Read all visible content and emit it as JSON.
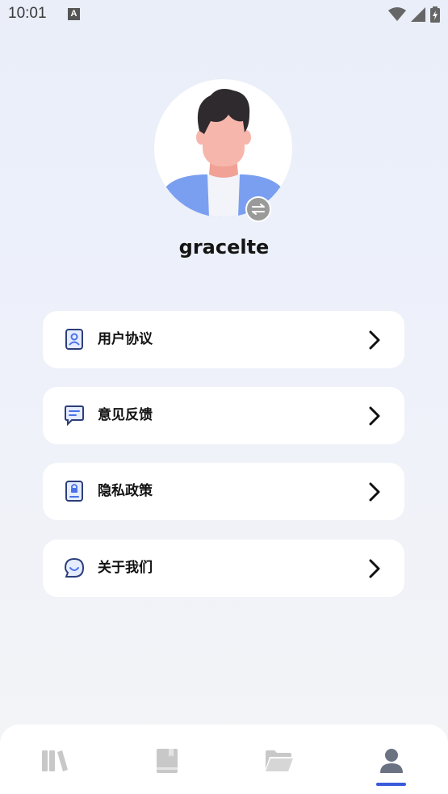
{
  "status_bar": {
    "time": "10:01",
    "notification_icon": "A"
  },
  "profile": {
    "username": "gracelte",
    "avatar_icon": "user-avatar-illustration",
    "swap_icon": "swap-arrows-icon"
  },
  "menu": [
    {
      "label": "用户协议",
      "icon": "user-agreement-icon"
    },
    {
      "label": "意见反馈",
      "icon": "feedback-message-icon"
    },
    {
      "label": "隐私政策",
      "icon": "privacy-lock-icon"
    },
    {
      "label": "关于我们",
      "icon": "about-chat-icon"
    }
  ],
  "tab_bar": {
    "tabs": [
      {
        "icon": "library-icon",
        "active": false
      },
      {
        "icon": "book-icon",
        "active": false
      },
      {
        "icon": "folder-icon",
        "active": false
      },
      {
        "icon": "profile-icon",
        "active": true
      }
    ]
  },
  "colors": {
    "accent": "#3a5bd9",
    "inactive_icon": "#c8c8c8",
    "active_icon": "#6b7281"
  }
}
